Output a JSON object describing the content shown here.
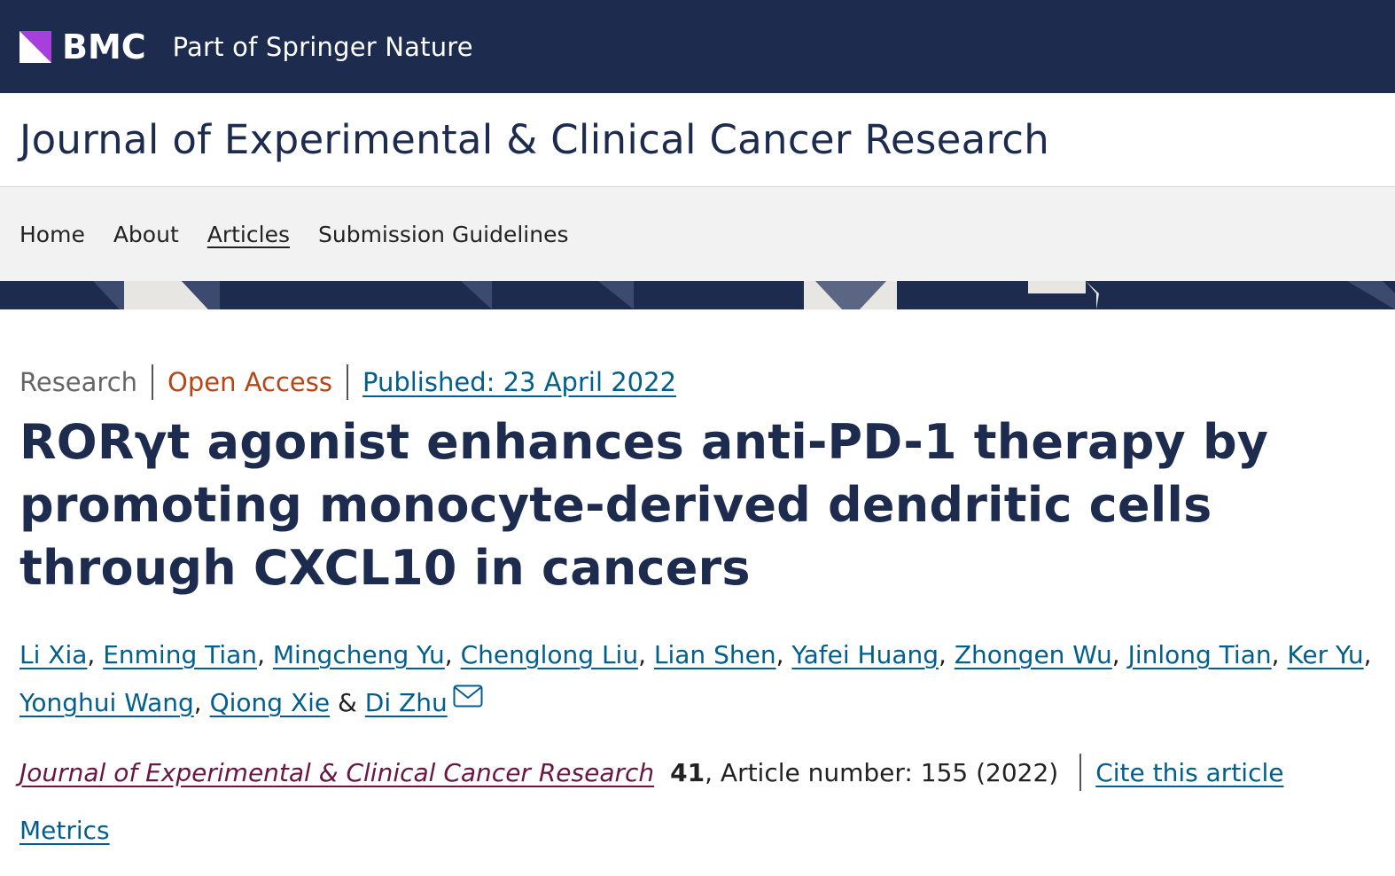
{
  "brand": {
    "logo_text": "BMC",
    "tagline": "Part of Springer Nature",
    "logo_color": "#a63fdb",
    "bar_color": "#1d2c4e"
  },
  "journal": {
    "title": "Journal of Experimental & Clinical Cancer Research"
  },
  "nav": {
    "items": [
      {
        "label": "Home",
        "active": false
      },
      {
        "label": "About",
        "active": false
      },
      {
        "label": "Articles",
        "active": true
      },
      {
        "label": "Submission Guidelines",
        "active": false
      }
    ]
  },
  "article": {
    "type": "Research",
    "access": "Open Access",
    "published": "Published: 23 April 2022",
    "title": "RORγt agonist enhances anti-PD-1 therapy by promoting monocyte-derived dendritic cells through CXCL10 in cancers",
    "authors": [
      "Li Xia",
      "Enming Tian",
      "Mingcheng Yu",
      "Chenglong Liu",
      "Lian Shen",
      "Yafei Huang",
      "Zhongen Wu",
      "Jinlong Tian",
      "Ker Yu",
      "Yonghui Wang",
      "Qiong Xie",
      "Di Zhu"
    ],
    "author_separator": ", ",
    "author_last_separator": " & ",
    "corresponding_icon": "envelope-icon"
  },
  "citation": {
    "journal": "Journal of Experimental & Clinical Cancer Research",
    "volume": "41",
    "details": ", Article number: 155 (2022)",
    "cite_link": "Cite this article"
  },
  "metrics": {
    "label": "Metrics"
  },
  "colors": {
    "link": "#025e8d",
    "open_access": "#b74616",
    "journal_link": "#6b1544",
    "title": "#1d2c4e"
  }
}
